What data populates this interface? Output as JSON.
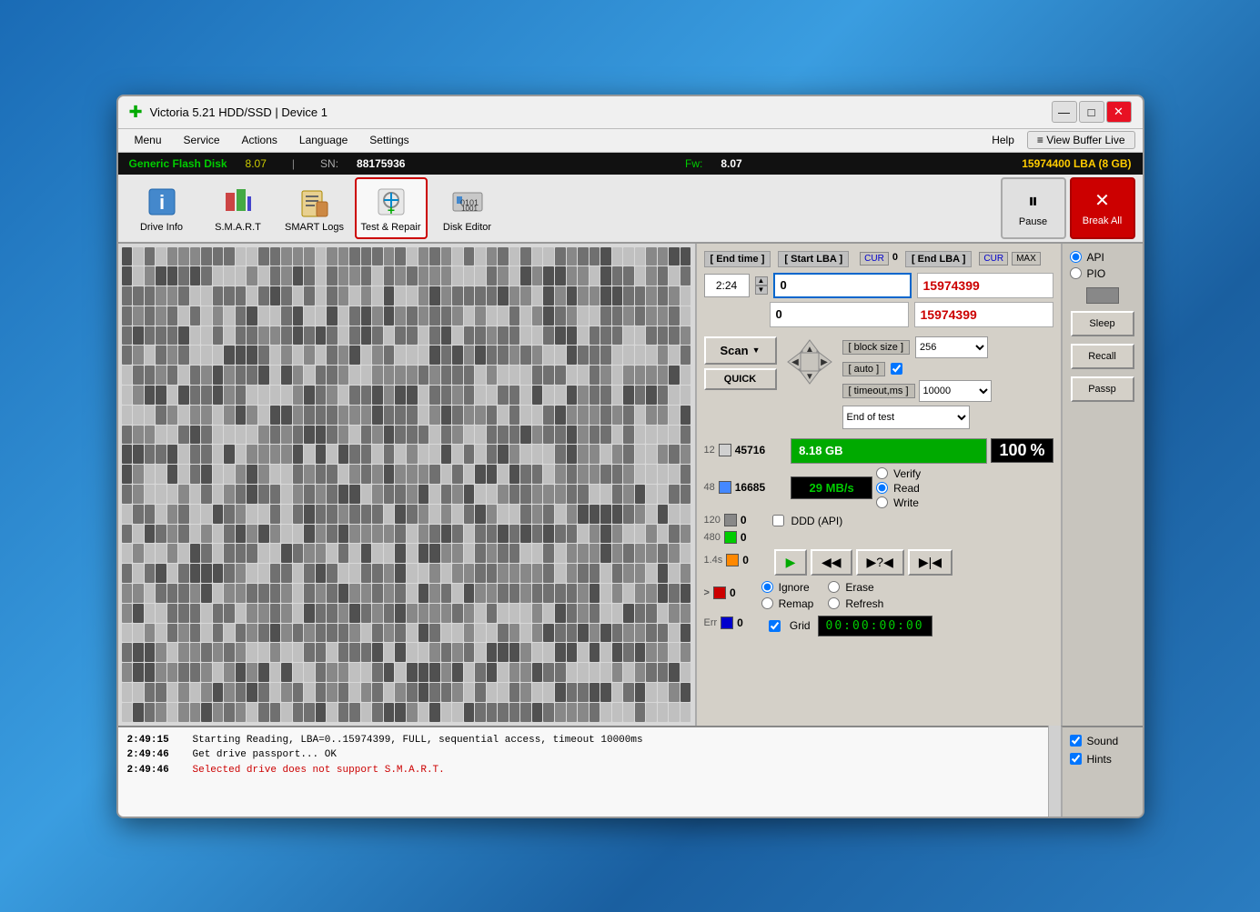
{
  "window": {
    "title": "Victoria 5.21 HDD/SSD | Device 1",
    "icon": "✚",
    "minimize": "—",
    "maximize": "□",
    "close": "✕"
  },
  "menu": {
    "items": [
      "Menu",
      "Service",
      "Actions",
      "Language",
      "Settings",
      "Help"
    ],
    "view_buffer": "≡ View Buffer Live"
  },
  "info_bar": {
    "disk_name": "Generic Flash Disk",
    "disk_size": "8.07",
    "sn_label": "SN:",
    "sn_value": "88175936",
    "fw_label": "Fw:",
    "fw_value": "8.07",
    "lba_info": "15974400 LBA (8 GB)"
  },
  "toolbar": {
    "drive_info": "Drive Info",
    "smart": "S.M.A.R.T",
    "smart_logs": "SMART Logs",
    "test_repair": "Test & Repair",
    "disk_editor": "Disk Editor",
    "pause": "Pause",
    "break_all": "Break All"
  },
  "control": {
    "end_time_label": "[ End time ]",
    "end_time_value": "2:24",
    "start_lba_label": "[ Start LBA ]",
    "cur_label": "CUR",
    "cur_value": "0",
    "end_lba_label": "[ End LBA ]",
    "max_label": "MAX",
    "start_lba_input": "0",
    "start_lba_display": "15974399",
    "end_lba_input": "0",
    "end_lba_display": "15974399",
    "block_size_label": "[ block size ]",
    "auto_label": "[ auto ]",
    "timeout_label": "[ timeout,ms ]",
    "block_size_value": "256",
    "timeout_value": "10000",
    "scan_label": "Scan",
    "quick_label": "QUICK",
    "end_of_test_label": "End of test",
    "progress_size": "8.18 GB",
    "progress_percent": "100",
    "progress_pct_sym": "%",
    "speed": "29 MB/s",
    "verify_label": "Verify",
    "read_label": "Read",
    "write_label": "Write",
    "ddd_label": "DDD (API)",
    "ignore_label": "Ignore",
    "erase_label": "Erase",
    "remap_label": "Remap",
    "refresh_label": "Refresh",
    "grid_label": "Grid",
    "grid_timer": "00:00:00:00",
    "stats": [
      {
        "color": "#d0d0d0",
        "label": "12",
        "value": "45716"
      },
      {
        "color": "#4488ff",
        "label": "48",
        "value": "16685"
      },
      {
        "color": "#888888",
        "label": "120",
        "value": "0"
      },
      {
        "color": "#00cc00",
        "label": "480",
        "value": "0"
      },
      {
        "color": "#ff8800",
        "label": "1.4s",
        "value": "0"
      },
      {
        "color": "#cc0000",
        "label": ">",
        "value": "0"
      },
      {
        "color": "#0000cc",
        "label": "Err",
        "value": "0"
      }
    ]
  },
  "side": {
    "api_label": "API",
    "pio_label": "PIO",
    "sleep_label": "Sleep",
    "recall_label": "Recall",
    "passp_label": "Passp"
  },
  "log": {
    "entries": [
      {
        "time": "2:49:15",
        "msg": "Starting Reading, LBA=0..15974399, FULL, sequential access, timeout 10000ms",
        "error": false
      },
      {
        "time": "2:49:46",
        "msg": "Get drive passport... OK",
        "error": false
      },
      {
        "time": "2:49:46",
        "msg": "Selected drive does not support S.M.A.R.T.",
        "error": true
      }
    ]
  },
  "bottom": {
    "sound_label": "Sound",
    "hints_label": "Hints"
  }
}
